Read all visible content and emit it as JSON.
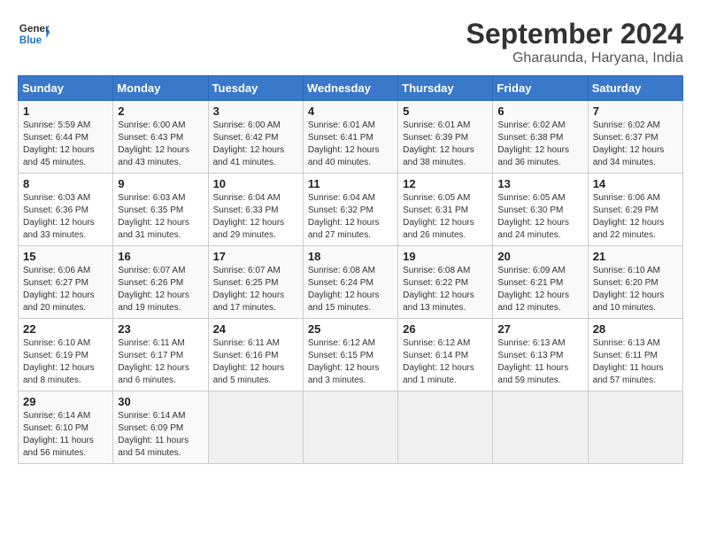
{
  "header": {
    "logo_general": "General",
    "logo_blue": "Blue",
    "month_year": "September 2024",
    "location": "Gharaunda, Haryana, India"
  },
  "weekdays": [
    "Sunday",
    "Monday",
    "Tuesday",
    "Wednesday",
    "Thursday",
    "Friday",
    "Saturday"
  ],
  "weeks": [
    [
      {
        "day": "1",
        "info": "Sunrise: 5:59 AM\nSunset: 6:44 PM\nDaylight: 12 hours\nand 45 minutes."
      },
      {
        "day": "2",
        "info": "Sunrise: 6:00 AM\nSunset: 6:43 PM\nDaylight: 12 hours\nand 43 minutes."
      },
      {
        "day": "3",
        "info": "Sunrise: 6:00 AM\nSunset: 6:42 PM\nDaylight: 12 hours\nand 41 minutes."
      },
      {
        "day": "4",
        "info": "Sunrise: 6:01 AM\nSunset: 6:41 PM\nDaylight: 12 hours\nand 40 minutes."
      },
      {
        "day": "5",
        "info": "Sunrise: 6:01 AM\nSunset: 6:39 PM\nDaylight: 12 hours\nand 38 minutes."
      },
      {
        "day": "6",
        "info": "Sunrise: 6:02 AM\nSunset: 6:38 PM\nDaylight: 12 hours\nand 36 minutes."
      },
      {
        "day": "7",
        "info": "Sunrise: 6:02 AM\nSunset: 6:37 PM\nDaylight: 12 hours\nand 34 minutes."
      }
    ],
    [
      {
        "day": "8",
        "info": "Sunrise: 6:03 AM\nSunset: 6:36 PM\nDaylight: 12 hours\nand 33 minutes."
      },
      {
        "day": "9",
        "info": "Sunrise: 6:03 AM\nSunset: 6:35 PM\nDaylight: 12 hours\nand 31 minutes."
      },
      {
        "day": "10",
        "info": "Sunrise: 6:04 AM\nSunset: 6:33 PM\nDaylight: 12 hours\nand 29 minutes."
      },
      {
        "day": "11",
        "info": "Sunrise: 6:04 AM\nSunset: 6:32 PM\nDaylight: 12 hours\nand 27 minutes."
      },
      {
        "day": "12",
        "info": "Sunrise: 6:05 AM\nSunset: 6:31 PM\nDaylight: 12 hours\nand 26 minutes."
      },
      {
        "day": "13",
        "info": "Sunrise: 6:05 AM\nSunset: 6:30 PM\nDaylight: 12 hours\nand 24 minutes."
      },
      {
        "day": "14",
        "info": "Sunrise: 6:06 AM\nSunset: 6:29 PM\nDaylight: 12 hours\nand 22 minutes."
      }
    ],
    [
      {
        "day": "15",
        "info": "Sunrise: 6:06 AM\nSunset: 6:27 PM\nDaylight: 12 hours\nand 20 minutes."
      },
      {
        "day": "16",
        "info": "Sunrise: 6:07 AM\nSunset: 6:26 PM\nDaylight: 12 hours\nand 19 minutes."
      },
      {
        "day": "17",
        "info": "Sunrise: 6:07 AM\nSunset: 6:25 PM\nDaylight: 12 hours\nand 17 minutes."
      },
      {
        "day": "18",
        "info": "Sunrise: 6:08 AM\nSunset: 6:24 PM\nDaylight: 12 hours\nand 15 minutes."
      },
      {
        "day": "19",
        "info": "Sunrise: 6:08 AM\nSunset: 6:22 PM\nDaylight: 12 hours\nand 13 minutes."
      },
      {
        "day": "20",
        "info": "Sunrise: 6:09 AM\nSunset: 6:21 PM\nDaylight: 12 hours\nand 12 minutes."
      },
      {
        "day": "21",
        "info": "Sunrise: 6:10 AM\nSunset: 6:20 PM\nDaylight: 12 hours\nand 10 minutes."
      }
    ],
    [
      {
        "day": "22",
        "info": "Sunrise: 6:10 AM\nSunset: 6:19 PM\nDaylight: 12 hours\nand 8 minutes."
      },
      {
        "day": "23",
        "info": "Sunrise: 6:11 AM\nSunset: 6:17 PM\nDaylight: 12 hours\nand 6 minutes."
      },
      {
        "day": "24",
        "info": "Sunrise: 6:11 AM\nSunset: 6:16 PM\nDaylight: 12 hours\nand 5 minutes."
      },
      {
        "day": "25",
        "info": "Sunrise: 6:12 AM\nSunset: 6:15 PM\nDaylight: 12 hours\nand 3 minutes."
      },
      {
        "day": "26",
        "info": "Sunrise: 6:12 AM\nSunset: 6:14 PM\nDaylight: 12 hours\nand 1 minute."
      },
      {
        "day": "27",
        "info": "Sunrise: 6:13 AM\nSunset: 6:13 PM\nDaylight: 11 hours\nand 59 minutes."
      },
      {
        "day": "28",
        "info": "Sunrise: 6:13 AM\nSunset: 6:11 PM\nDaylight: 11 hours\nand 57 minutes."
      }
    ],
    [
      {
        "day": "29",
        "info": "Sunrise: 6:14 AM\nSunset: 6:10 PM\nDaylight: 11 hours\nand 56 minutes."
      },
      {
        "day": "30",
        "info": "Sunrise: 6:14 AM\nSunset: 6:09 PM\nDaylight: 11 hours\nand 54 minutes."
      },
      {
        "day": "",
        "info": ""
      },
      {
        "day": "",
        "info": ""
      },
      {
        "day": "",
        "info": ""
      },
      {
        "day": "",
        "info": ""
      },
      {
        "day": "",
        "info": ""
      }
    ]
  ]
}
